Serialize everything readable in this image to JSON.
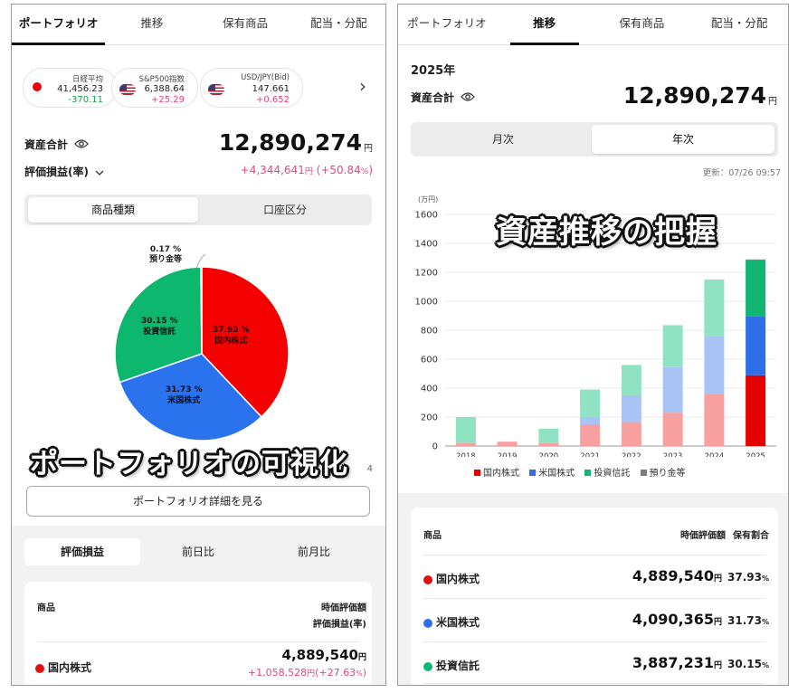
{
  "left": {
    "tabs": [
      "ポートフォリオ",
      "推移",
      "保有商品",
      "配当・分配"
    ],
    "active_tab": 0,
    "tickers": [
      {
        "name": "日経平均",
        "value": "41,456.23",
        "change": "-370.11",
        "change_dir": "down",
        "flag": "jp"
      },
      {
        "name": "S&P500指数",
        "value": "6,388.64",
        "change": "+25.29",
        "change_dir": "up",
        "flag": "us"
      },
      {
        "name": "USD/JPY(Bid)",
        "value": "147.661",
        "change": "+0.652",
        "change_dir": "up",
        "flag": "us"
      }
    ],
    "chevron": "›",
    "total_label": "資産合計",
    "total_value": "12,890,274",
    "yen": "円",
    "pl_label": "評価損益(率)",
    "pl_value": "+4,344,641",
    "pl_rate_open": "(+50.84",
    "pl_rate_pct": "%",
    "pl_rate_close": ")",
    "segment": [
      "商品種類",
      "口座区分"
    ],
    "segment_active": 0,
    "pie": [
      {
        "label": "国内株式",
        "pct": "37.93 %",
        "value": 37.93,
        "color": "#f40000"
      },
      {
        "label": "米国株式",
        "pct": "31.73 %",
        "value": 31.73,
        "color": "#2a72ee"
      },
      {
        "label": "投資信託",
        "pct": "30.15 %",
        "value": 30.15,
        "color": "#0db86e"
      },
      {
        "label": "預り金等",
        "pct": "0.17 %",
        "value": 0.17,
        "color": "#f2c14e"
      }
    ],
    "overlay_caption": "ポートフォリオの可視化",
    "partial_char": "4",
    "detail_button": "ポートフォリオ詳細を見る",
    "subtabs": [
      "評価損益",
      "前日比",
      "前月比"
    ],
    "subtab_active": 0,
    "table_header": {
      "product": "商品",
      "col1": "時価評価額",
      "col2": "評価損益(率)"
    },
    "rows": [
      {
        "name": "国内株式",
        "color": "#e01010",
        "value": "4,889,540",
        "yen": "円",
        "pl": "+1,058,528",
        "pl_yen": "円",
        "pl_rate": "(+27.63",
        "pl_pct": "%",
        "pl_close": ")"
      }
    ]
  },
  "right": {
    "tabs": [
      "ポートフォリオ",
      "推移",
      "保有商品",
      "配当・分配"
    ],
    "active_tab": 1,
    "year": "2025年",
    "total_label": "資産合計",
    "total_value": "12,890,274",
    "yen": "円",
    "segment": [
      "月次",
      "年次"
    ],
    "segment_active": 1,
    "updated": "更新：07/26 09:57",
    "overlay_caption": "資産推移の把握",
    "chart_data": {
      "type": "bar",
      "stacked": true,
      "unit_label": "(万円)",
      "categories": [
        "2018",
        "2019",
        "2020",
        "2021",
        "2022",
        "2023",
        "2024",
        "2025"
      ],
      "ylim": [
        0,
        1600
      ],
      "yticks": [
        0,
        200,
        400,
        600,
        800,
        1000,
        1200,
        1400,
        1600
      ],
      "series": [
        {
          "name": "国内株式",
          "color": "#e50000",
          "faded_color": "#f8a0a0",
          "values": [
            20,
            30,
            20,
            150,
            165,
            230,
            360,
            489
          ]
        },
        {
          "name": "米国株式",
          "color": "#2e6fe8",
          "faded_color": "#a9c3f7",
          "values": [
            0,
            0,
            0,
            50,
            185,
            315,
            400,
            409
          ]
        },
        {
          "name": "投資信託",
          "color": "#13b573",
          "faded_color": "#8fe3c2",
          "values": [
            180,
            0,
            100,
            190,
            210,
            290,
            390,
            389
          ]
        },
        {
          "name": "預り金等",
          "color": "#7d7d7d",
          "faded_color": "#bdbdbd",
          "values": [
            0,
            0,
            0,
            0,
            0,
            0,
            0,
            2
          ]
        }
      ],
      "highlight_category": "2025"
    },
    "table_header": {
      "product": "商品",
      "col1": "時価評価額",
      "col2": "保有割合"
    },
    "rows": [
      {
        "name": "国内株式",
        "color": "#e01010",
        "value": "4,889,540",
        "yen": "円",
        "pct": "37.93",
        "pct_unit": "%"
      },
      {
        "name": "米国株式",
        "color": "#2e6fe8",
        "value": "4,090,365",
        "yen": "円",
        "pct": "31.73",
        "pct_unit": "%"
      },
      {
        "name": "投資信託",
        "color": "#13b573",
        "value": "3,887,231",
        "yen": "円",
        "pct": "30.15",
        "pct_unit": "%"
      }
    ]
  }
}
